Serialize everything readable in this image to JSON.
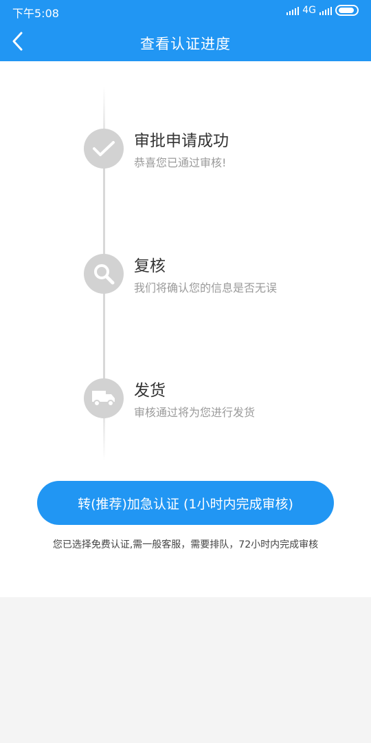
{
  "status_bar": {
    "time": "下午5:08",
    "network": "4G"
  },
  "header": {
    "title": "查看认证进度",
    "back_icon": "chevron-left-icon"
  },
  "steps": [
    {
      "title": "审批申请成功",
      "desc": "恭喜您已通过审核!",
      "icon": "checkmark-icon"
    },
    {
      "title": "复核",
      "desc": "我们将确认您的信息是否无误",
      "icon": "search-icon"
    },
    {
      "title": "发货",
      "desc": "审核通过将为您进行发货",
      "icon": "truck-icon"
    }
  ],
  "urgent_button": {
    "label": "转(推荐)加急认证 (1小时内完成审核)"
  },
  "notice": "您已选择免费认证,需一般客服，需要排队，72小时内完成审核",
  "colors": {
    "primary": "#2196f3",
    "icon_bg": "#d2d2d2",
    "timeline": "#d8d8d8",
    "page_bg": "#f4f4f4"
  }
}
